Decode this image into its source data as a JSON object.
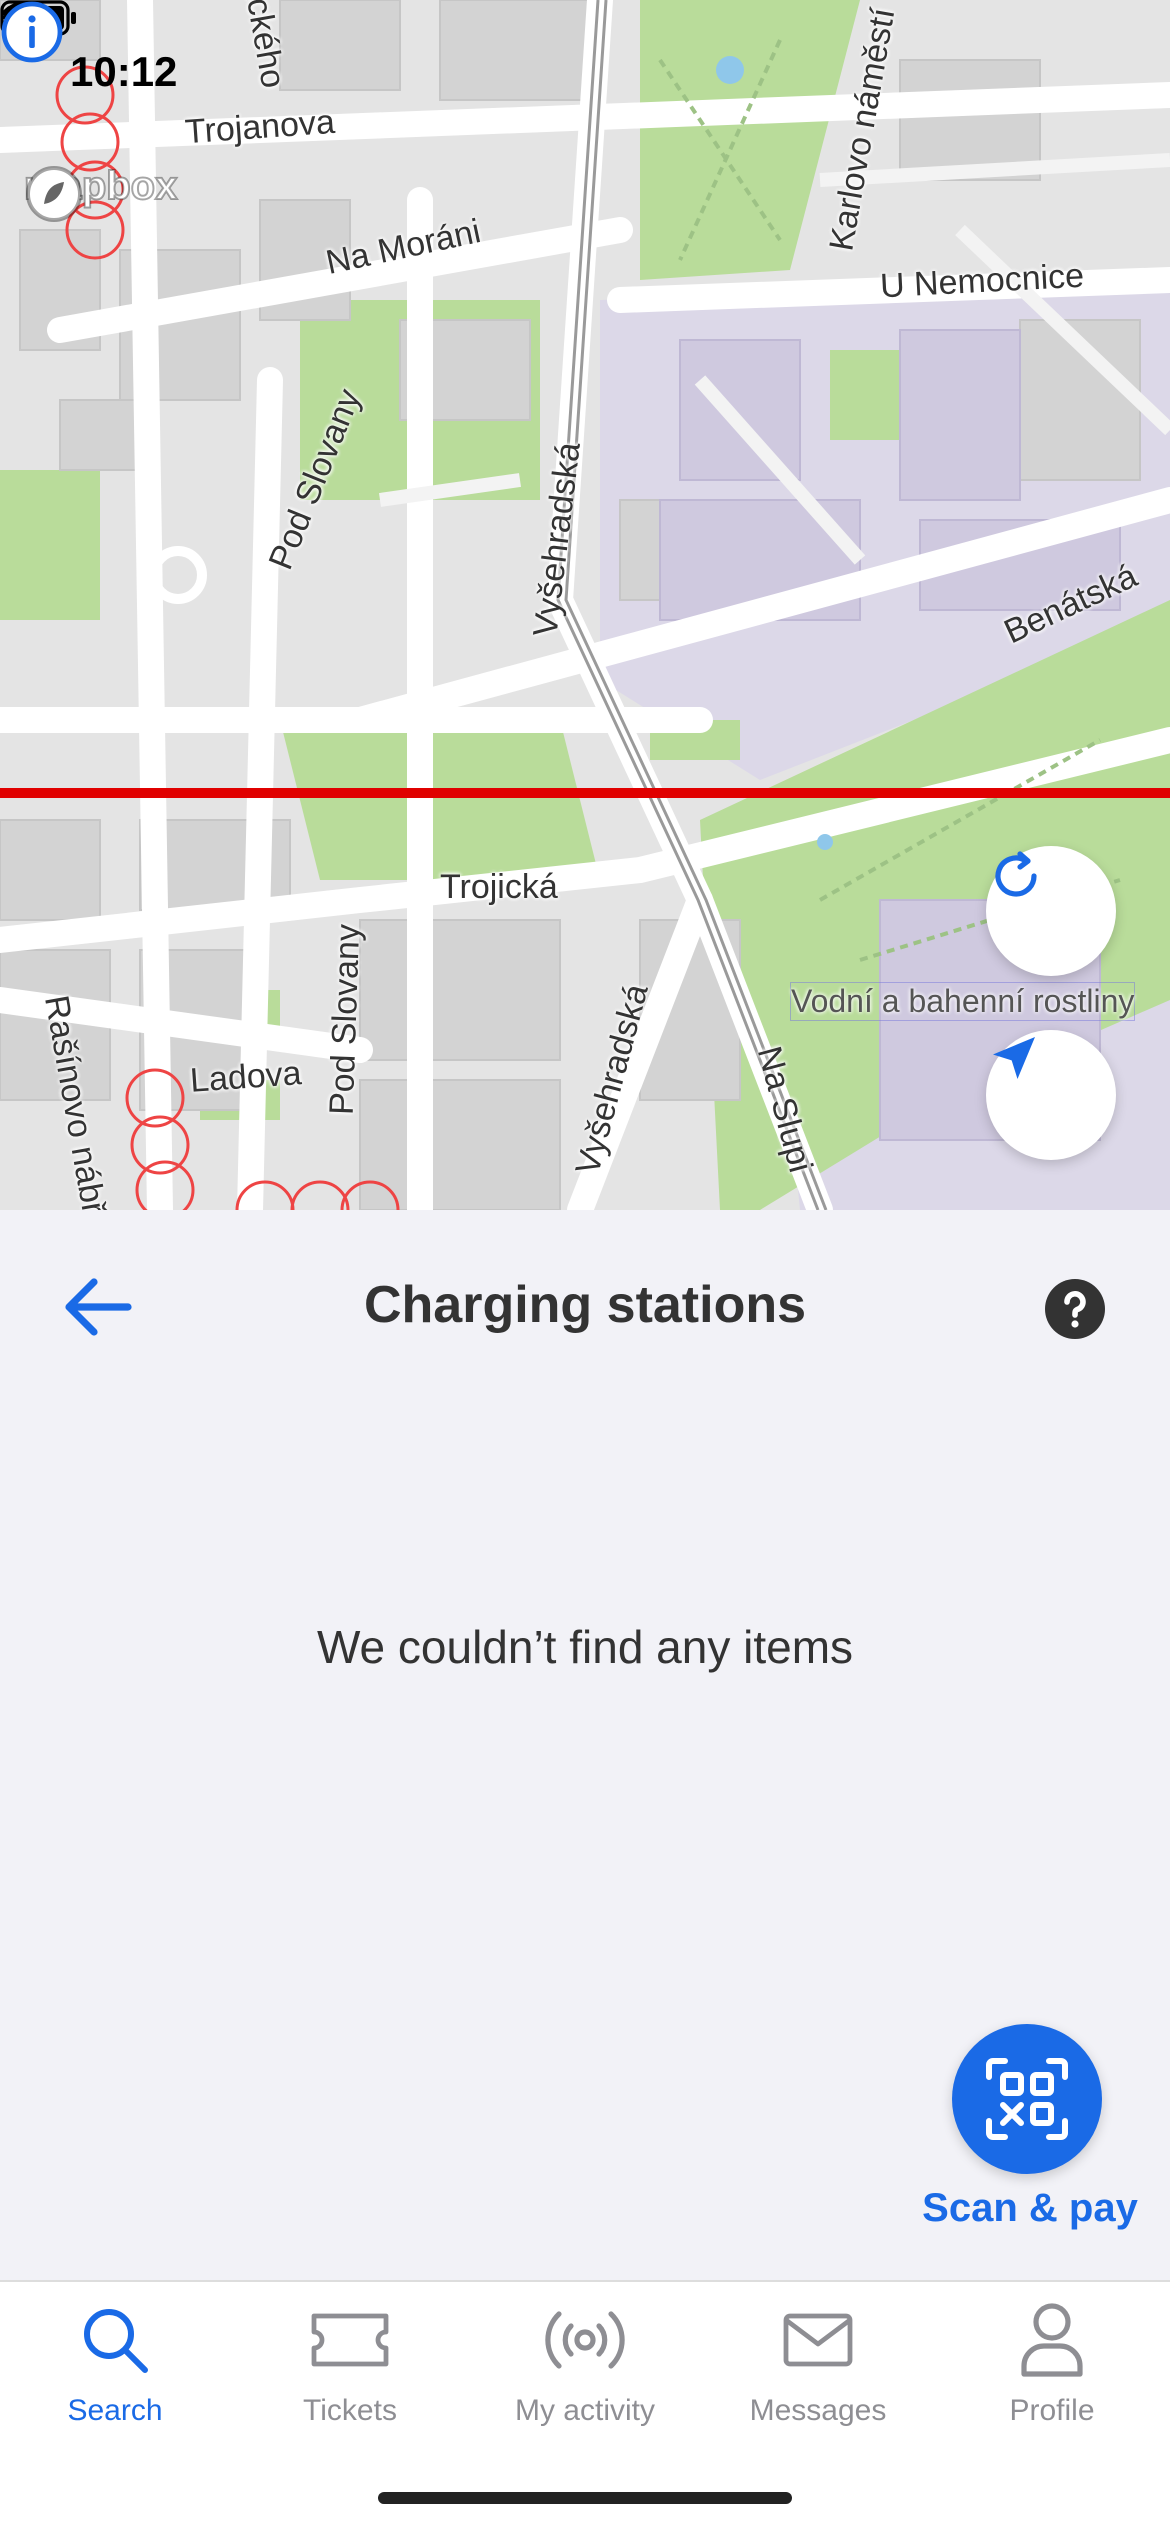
{
  "status_bar": {
    "time": "10:12",
    "icons": [
      "location-arrow-icon",
      "wifi-icon",
      "battery-icon"
    ]
  },
  "map": {
    "attribution": "mapbox",
    "street_labels": {
      "trojanova": "Trojanova",
      "na_morani": "Na Moráni",
      "karlovo_namesti": "Karlovo náměstí",
      "u_nemocnice": "U Nemocnice",
      "pod_slovany_top": "Pod Slovany",
      "vysehradska_top": "Vyšehradská",
      "benatska": "Benátská",
      "trojicka": "Trojická",
      "pod_slovany_bottom": "Pod Slovany",
      "vysehradska_bottom": "Vyšehradská",
      "na_slupi": "Na Slupi",
      "ladova": "Ladova",
      "rasinovo_nabrezi": "Rašínovo nábř.",
      "palackeho": "Palackého"
    },
    "poi_label": "Vodní a bahenní rostliny",
    "colors": {
      "park": "#b9dc9a",
      "street": "#ffffff",
      "building": "#d6d6d6",
      "residential": "#dcd8e8"
    }
  },
  "panel": {
    "title": "Charging stations",
    "empty_message": "We couldn’t find any items"
  },
  "scan": {
    "label": "Scan & pay"
  },
  "tabs": [
    {
      "label": "Search",
      "icon": "search-icon",
      "active": true
    },
    {
      "label": "Tickets",
      "icon": "ticket-icon",
      "active": false
    },
    {
      "label": "My activity",
      "icon": "broadcast-icon",
      "active": false
    },
    {
      "label": "Messages",
      "icon": "envelope-icon",
      "active": false
    },
    {
      "label": "Profile",
      "icon": "person-icon",
      "active": false
    }
  ],
  "accent_color": "#1a6ae6"
}
